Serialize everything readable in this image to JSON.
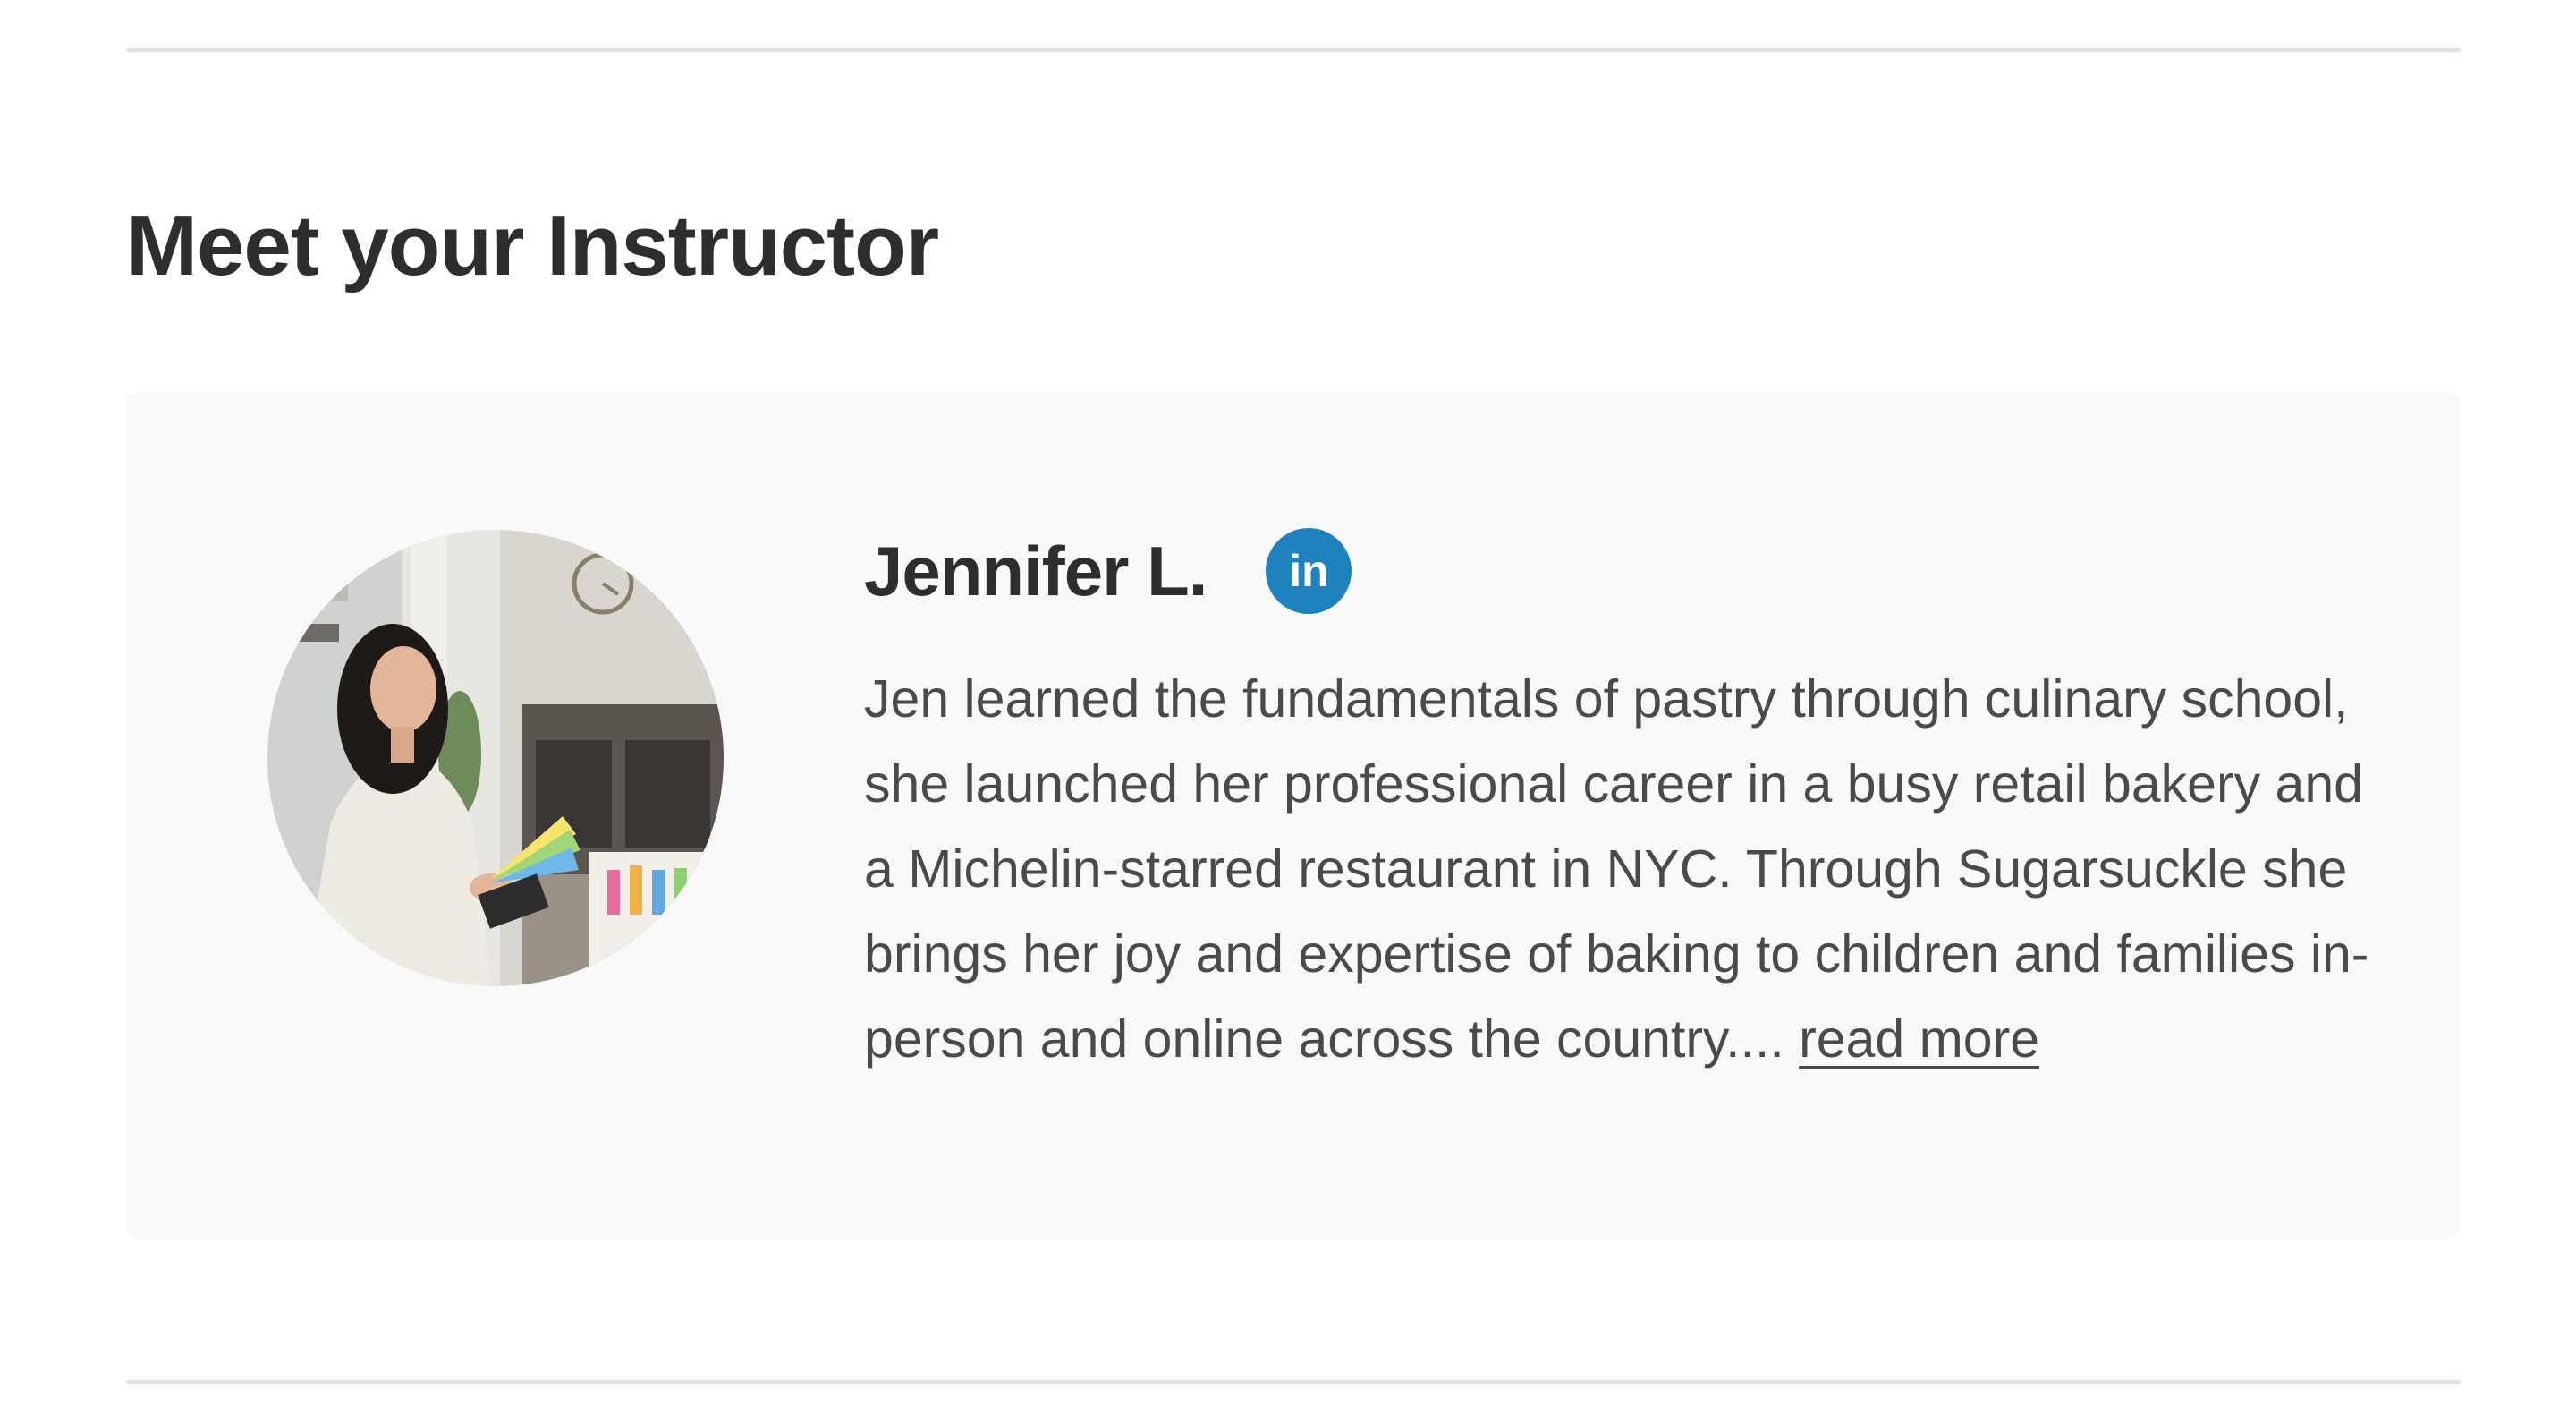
{
  "section": {
    "title": "Meet your Instructor"
  },
  "instructor": {
    "name": "Jennifer L.",
    "linkedin_icon_text": "in",
    "linkedin_color": "#1d82bd",
    "photo_icon": "instructor-photo",
    "bio": "Jen learned the fundamentals of pastry through culinary school, she launched her professional career in a busy retail bakery and a Michelin-starred restaurant in NYC. Through Sugarsuckle she brings her joy and expertise of baking to children and families in-person and online across the country....",
    "read_more_label": "read more"
  },
  "colors": {
    "card_background": "#f9f9f9",
    "divider": "#e3e3e3",
    "heading_text": "#2e2e2e",
    "body_text": "#4a4a4a"
  }
}
